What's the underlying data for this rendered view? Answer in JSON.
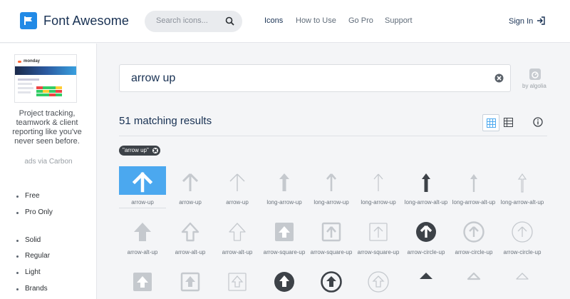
{
  "header": {
    "brand": "Font Awesome",
    "search_placeholder": "Search icons...",
    "nav": [
      "Icons",
      "How to Use",
      "Go Pro",
      "Support"
    ],
    "sign_in": "Sign In"
  },
  "sidebar": {
    "ad_brand": "monday",
    "ad_text": "Project tracking, teamwork & client reporting like you've never seen before.",
    "ad_via": "ads via Carbon",
    "filters_1": [
      "Free",
      "Pro Only"
    ],
    "filters_2": [
      "Solid",
      "Regular",
      "Light",
      "Brands"
    ]
  },
  "main": {
    "search_value": "arrow up",
    "algolia": "by algolia",
    "results": "51 matching results",
    "tag": "\"arrow up\"",
    "icons": [
      {
        "label": "arrow-up",
        "icon": "arrow-up-icon"
      },
      {
        "label": "arrow-up",
        "icon": "arrow-up-icon"
      },
      {
        "label": "arrow-up",
        "icon": "arrow-up-icon"
      },
      {
        "label": "long-arrow-up",
        "icon": "long-arrow-up-icon"
      },
      {
        "label": "long-arrow-up",
        "icon": "long-arrow-up-icon"
      },
      {
        "label": "long-arrow-up",
        "icon": "long-arrow-up-icon"
      },
      {
        "label": "long-arrow-alt-up",
        "icon": "long-arrow-alt-up-icon"
      },
      {
        "label": "long-arrow-alt-up",
        "icon": "long-arrow-alt-up-icon"
      },
      {
        "label": "long-arrow-alt-up",
        "icon": "long-arrow-alt-up-icon"
      },
      {
        "label": "arrow-alt-up",
        "icon": "arrow-alt-up-icon"
      },
      {
        "label": "arrow-alt-up",
        "icon": "arrow-alt-up-icon"
      },
      {
        "label": "arrow-alt-up",
        "icon": "arrow-alt-up-icon"
      },
      {
        "label": "arrow-square-up",
        "icon": "arrow-square-up-icon"
      },
      {
        "label": "arrow-square-up",
        "icon": "arrow-square-up-icon"
      },
      {
        "label": "arrow-square-up",
        "icon": "arrow-square-up-icon"
      },
      {
        "label": "arrow-circle-up",
        "icon": "arrow-circle-up-icon"
      },
      {
        "label": "arrow-circle-up",
        "icon": "arrow-circle-up-icon"
      },
      {
        "label": "arrow-circle-up",
        "icon": "arrow-circle-up-icon"
      }
    ]
  },
  "colors": {
    "accent": "#4ba8ef",
    "brand": "#228ae6",
    "dark": "#183153"
  }
}
